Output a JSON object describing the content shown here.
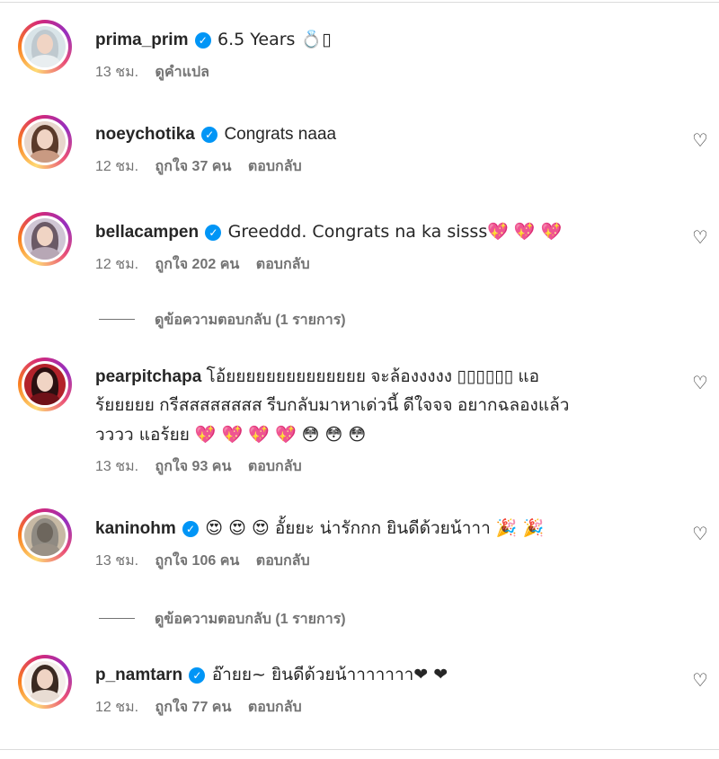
{
  "comments": [
    {
      "username": "prima_prim",
      "verified": true,
      "text": "6.5 Years 💍▯",
      "time": "13 ชม.",
      "likes": "",
      "reply": "ดูคำแปล",
      "has_heart": false
    },
    {
      "username": "noeychotika",
      "verified": true,
      "text": "Congrats naaa",
      "time": "12 ชม.",
      "likes": "ถูกใจ 37 คน",
      "reply": "ตอบกลับ",
      "has_heart": true
    },
    {
      "username": "bellacampen",
      "verified": true,
      "text": "Greeddd. Congrats na ka sisss💖 💖 💖",
      "time": "12 ชม.",
      "likes": "ถูกใจ 202 คน",
      "reply": "ตอบกลับ",
      "has_heart": true
    },
    {
      "username": "pearpitchapa",
      "verified": false,
      "text": "โอ้ยยยยยยยยยยยยยย จะล้องงงงง ▯▯▯▯▯▯ แอ",
      "text2": "ร้ยยยยย กรีสสสสสสสส รีบกลับมาหาเด่วนี้ ดีใจจจ อยากฉลองแล้ว",
      "text3": "วววว แอร้ยย 💖 💖 💖 💖 😳 😳 😳",
      "time": "13 ชม.",
      "likes": "ถูกใจ 93 คน",
      "reply": "ตอบกลับ",
      "has_heart": true
    },
    {
      "username": "kaninohm",
      "verified": true,
      "text": "😍 😍 😍 อั้ยยะ น่ารักกก ยินดีด้วยน้าาา 🎉 🎉",
      "time": "13 ชม.",
      "likes": "ถูกใจ 106 คน",
      "reply": "ตอบกลับ",
      "has_heart": true
    },
    {
      "username": "p_namtarn",
      "verified": true,
      "text": "อ๊ายย~ ยินดีด้วยน้าาาาาาา❤ ❤",
      "time": "12 ชม.",
      "likes": "ถูกใจ 77 คน",
      "reply": "ตอบกลับ",
      "has_heart": true
    }
  ],
  "view_replies": [
    "ดูข้อความตอบกลับ (1 รายการ)",
    "ดูข้อความตอบกลับ (1 รายการ)"
  ],
  "icons": {
    "verified": "verified-check-icon",
    "heart": "heart-outline-icon"
  },
  "colors": {
    "verified": "#0095f6",
    "meta": "#737373",
    "text": "#262626"
  }
}
